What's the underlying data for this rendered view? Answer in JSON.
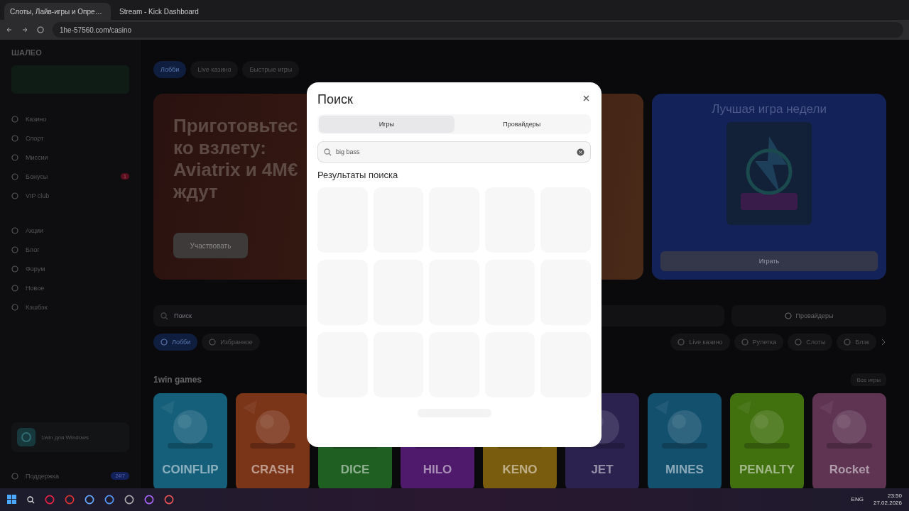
{
  "browser": {
    "tabs": [
      {
        "title": "Слоты, Лайв-игры и Опре…",
        "selected": true
      },
      {
        "title": "Stream - Kick Dashboard",
        "selected": false
      }
    ],
    "url": "1he-57560.com/casino"
  },
  "sidebar": {
    "brand": "ШАЛЕО",
    "nav": [
      {
        "label": "Казино"
      },
      {
        "label": "Спорт"
      },
      {
        "label": "Миссии"
      },
      {
        "label": "Бонусы",
        "badge": "1"
      },
      {
        "label": "VIP club"
      }
    ],
    "nav2": [
      {
        "label": "Акции"
      },
      {
        "label": "Блог"
      },
      {
        "label": "Форум"
      },
      {
        "label": "Новое"
      },
      {
        "label": "Кэшбэк"
      }
    ],
    "app_title": "1win для Windows",
    "support": "Поддержка",
    "support_badge": "24/7"
  },
  "top_tabs": [
    {
      "label": "Лобби",
      "selected": true
    },
    {
      "label": "Live казино",
      "selected": false
    },
    {
      "label": "Быстрые игры",
      "selected": false
    }
  ],
  "hero": {
    "title_lines": [
      "Приготовьтес",
      "ко взлету:",
      "Aviatrix и 4M€",
      "ждут"
    ],
    "button": "Участвовать"
  },
  "game_of_week": {
    "title": "Лучшая игра недели",
    "button": "Играть"
  },
  "search_bar": {
    "placeholder": "Поиск",
    "providers_button": "Провайдеры"
  },
  "categories_left": [
    {
      "label": "Лобби",
      "selected": true
    },
    {
      "label": "Избранное",
      "selected": false
    }
  ],
  "categories_right": [
    {
      "label": "Live казино",
      "selected": false
    },
    {
      "label": "Рулетка",
      "selected": false
    },
    {
      "label": "Слоты",
      "selected": false
    },
    {
      "label": "Блэк",
      "selected": false
    }
  ],
  "section": {
    "title": "1win games",
    "see_all": "Все игры"
  },
  "games": [
    {
      "name": "COINFLIP",
      "color": "#155f7a"
    },
    {
      "name": "CRASH",
      "color": "#7a3418"
    },
    {
      "name": "DICE",
      "color": "#1f5f22"
    },
    {
      "name": "HILO",
      "color": "#4f1a6c"
    },
    {
      "name": "KENO",
      "color": "#7a5c0e"
    },
    {
      "name": "JET",
      "color": "#2c2250"
    },
    {
      "name": "MINES",
      "color": "#13506e"
    },
    {
      "name": "PENALTY",
      "color": "#41700f"
    },
    {
      "name": "Rocket",
      "color": "#5e3452"
    }
  ],
  "modal": {
    "title": "Поиск",
    "tabs": [
      {
        "label": "Игры",
        "selected": true
      },
      {
        "label": "Провайдеры",
        "selected": false
      }
    ],
    "query": "big bass",
    "results_title": "Результаты поиска",
    "loading": true
  },
  "taskbar": {
    "language": "ENG",
    "time": "23:50",
    "date": "27.02.2026"
  }
}
